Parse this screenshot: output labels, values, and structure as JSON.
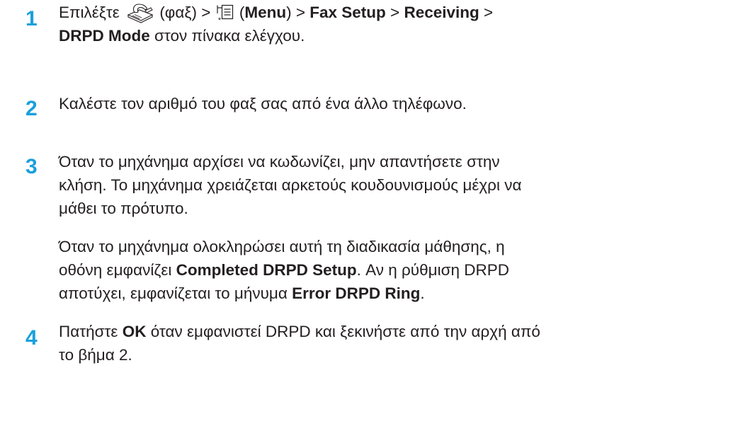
{
  "steps": [
    {
      "number": "1",
      "t1": "Επιλέξτε ",
      "t2": " (φαξ) > ",
      "t3": " (",
      "menu": "Menu",
      "t4": ") > ",
      "fax_setup": "Fax Setup",
      "t5": " > ",
      "receiving": "Receiving",
      "t6": " >",
      "drpd_mode": "DRPD Mode",
      "t7": " στον πίνακα ελέγχου.",
      "icons": [
        "fax-icon",
        "menu-icon"
      ]
    },
    {
      "number": "2",
      "text": "Καλέστε τον αριθμό του φαξ σας από ένα άλλο τηλέφωνο."
    },
    {
      "number": "3",
      "line1": "Όταν το μηχάνημα αρχίσει να κωδωνίζει, μην απαντήσετε στην",
      "line2": "κλήση. Το μηχάνημα χρειάζεται αρκετούς κουδουνισμούς μέχρι να",
      "line3": "μάθει το πρότυπο.",
      "p2_line1": "Όταν το μηχάνημα ολοκληρώσει αυτή τη διαδικασία μάθησης, η",
      "p2_t1": "οθόνη εμφανίζει ",
      "completed": "Completed DRPD Setup",
      "p2_t2": ". Αν η ρύθμιση DRPD",
      "p2_t3": "αποτύχει, εμφανίζεται το μήνυμα ",
      "error": "Error DRPD Ring",
      "p2_t4": "."
    },
    {
      "number": "4",
      "t1": "Πατήστε ",
      "ok": "OK",
      "t2": " όταν εμφανιστεί DRPD και ξεκινήστε από την αρχή από",
      "line2": "το βήμα 2."
    }
  ]
}
